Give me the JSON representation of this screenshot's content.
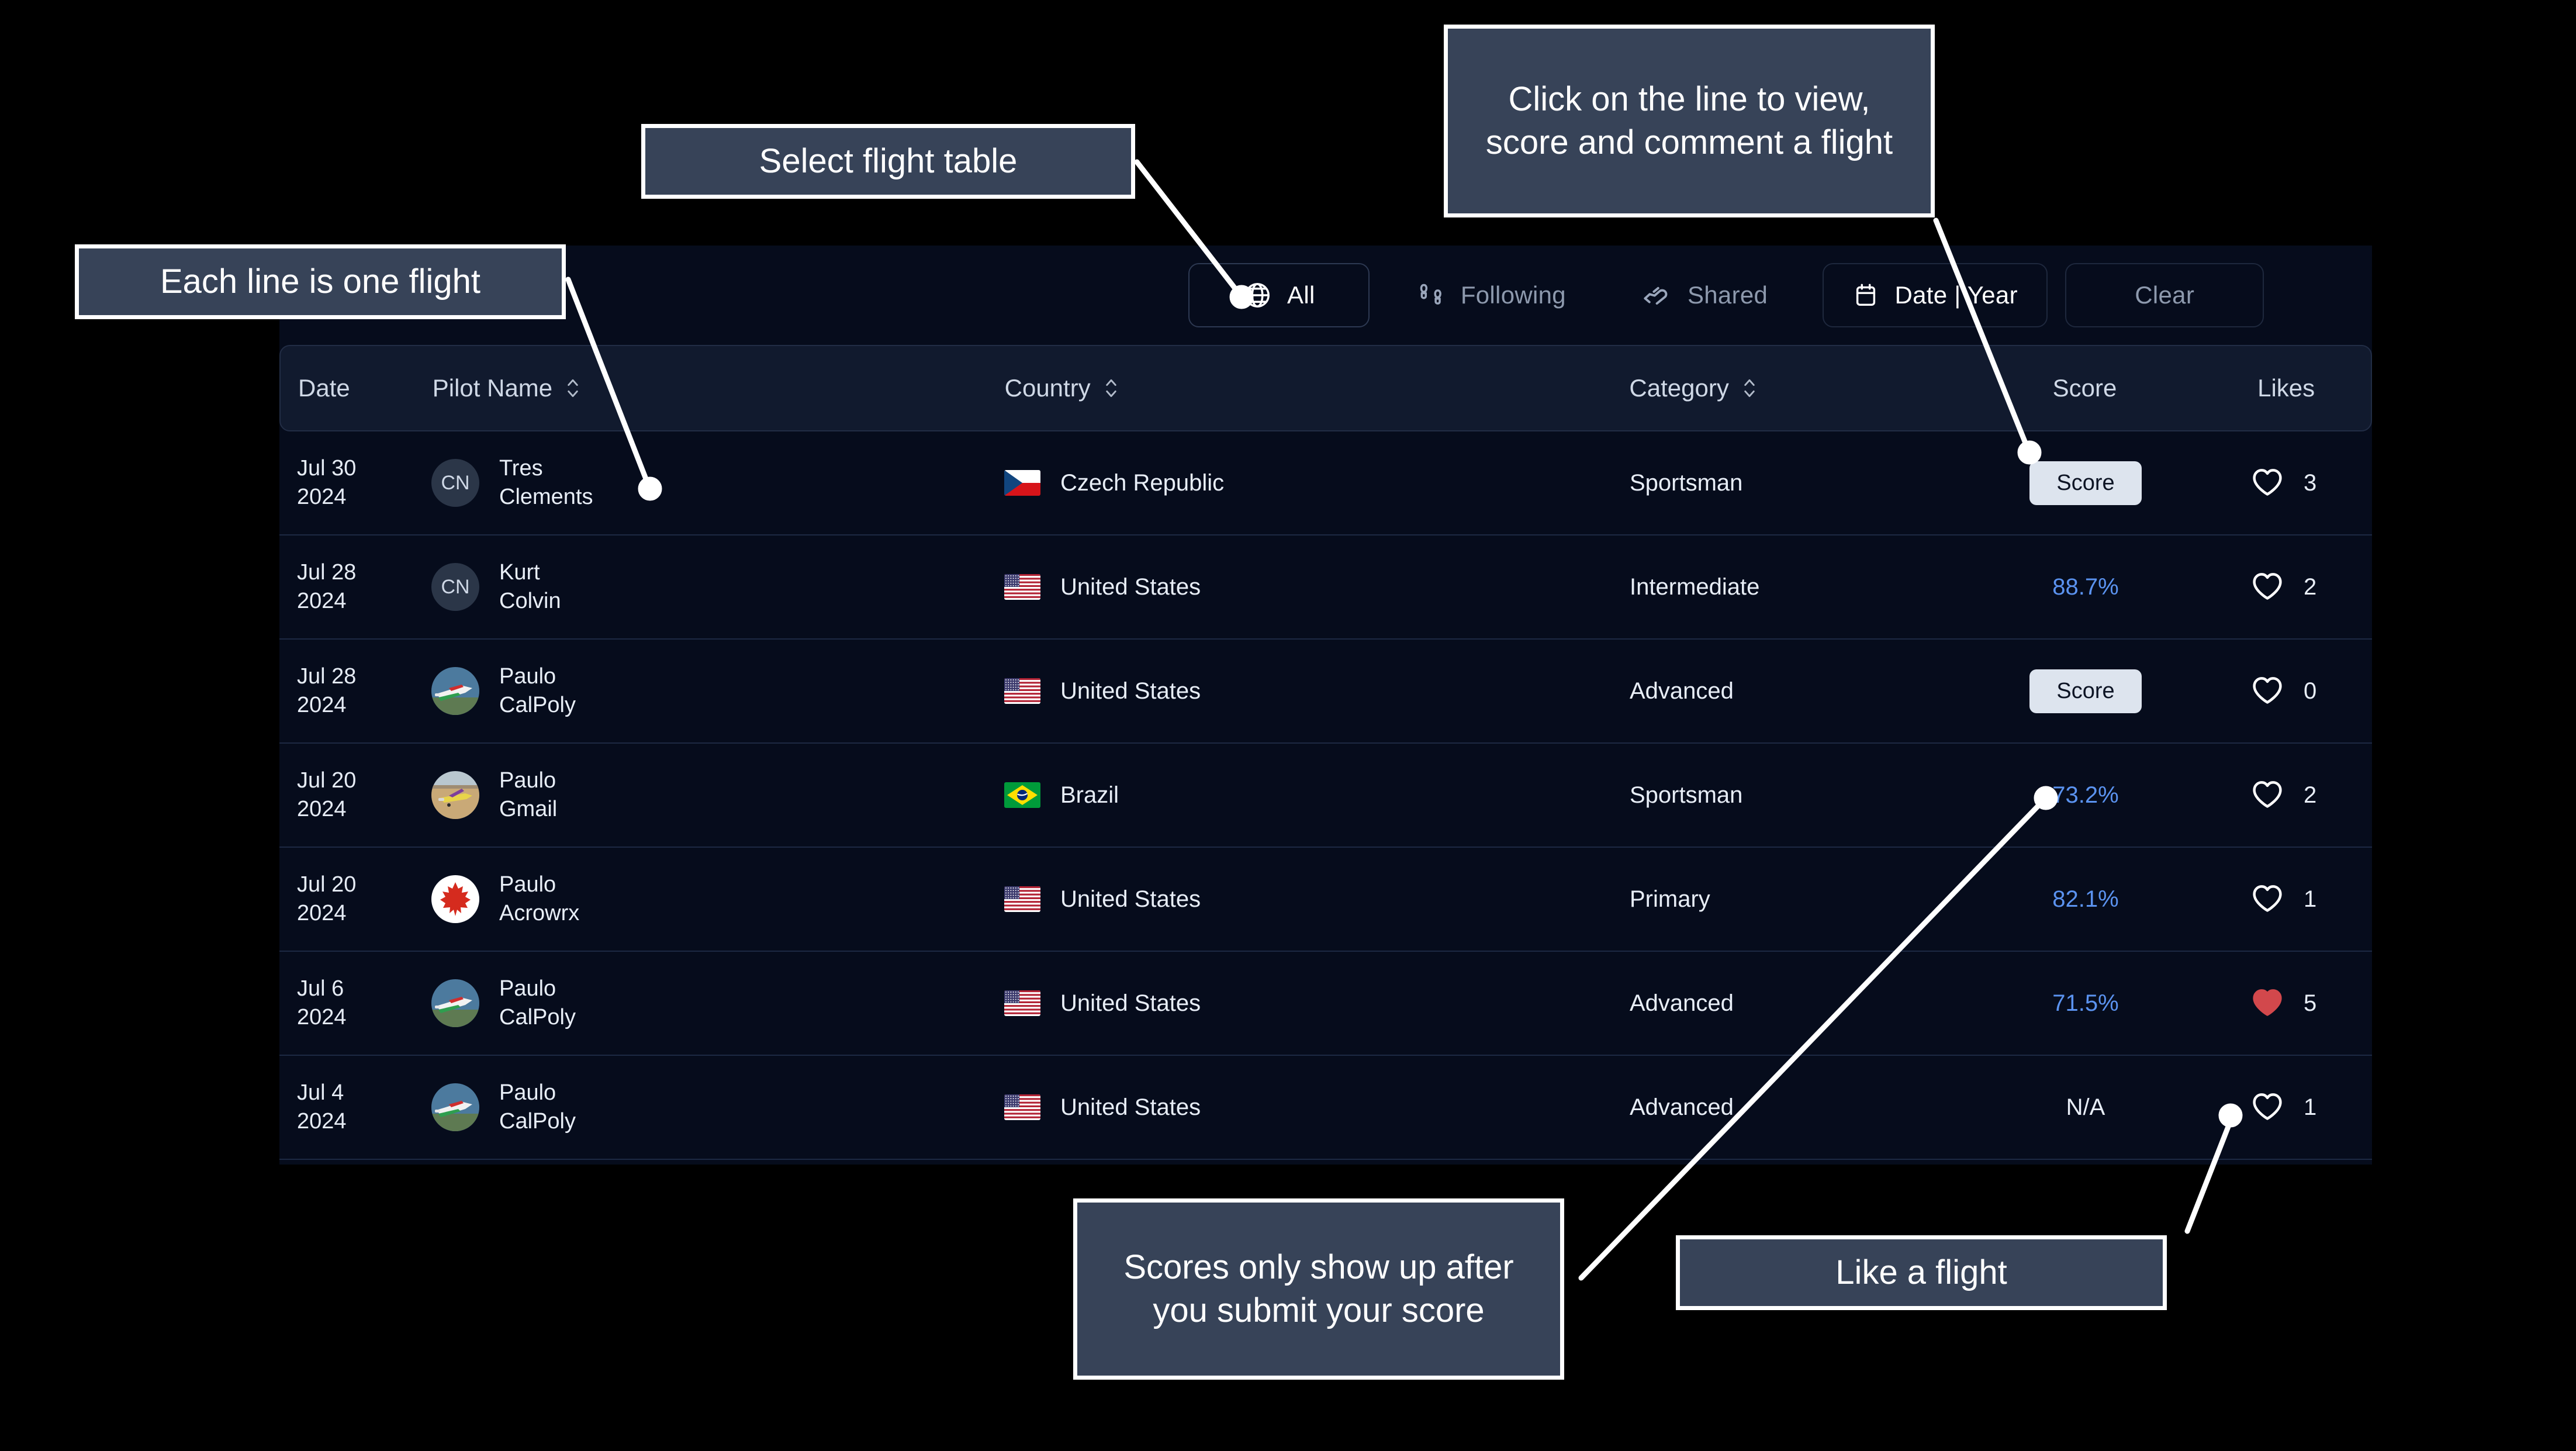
{
  "toolbar": {
    "all_label": "All",
    "following_label": "Following",
    "shared_label": "Shared",
    "date_label": "Date | Year",
    "clear_label": "Clear",
    "icons": {
      "all": "globe-icon",
      "following": "footprints-icon",
      "shared": "handshake-icon",
      "date": "calendar-icon"
    }
  },
  "table": {
    "columns": [
      {
        "key": "date",
        "label": "Date",
        "sortable": false
      },
      {
        "key": "pilot",
        "label": "Pilot Name",
        "sortable": true
      },
      {
        "key": "country",
        "label": "Country",
        "sortable": true
      },
      {
        "key": "category",
        "label": "Category",
        "sortable": true
      },
      {
        "key": "score",
        "label": "Score",
        "sortable": false
      },
      {
        "key": "likes",
        "label": "Likes",
        "sortable": false
      }
    ],
    "rows": [
      {
        "date_day": "Jul 30",
        "date_year": "2024",
        "avatar_type": "initials",
        "avatar_initials": "CN",
        "pilot_first": "Tres",
        "pilot_last": "Clements",
        "country": "Czech Republic",
        "flag": "cz",
        "category": "Sportsman",
        "score_type": "button",
        "score": "Score",
        "likes": "3",
        "liked": false
      },
      {
        "date_day": "Jul 28",
        "date_year": "2024",
        "avatar_type": "initials",
        "avatar_initials": "CN",
        "pilot_first": "Kurt",
        "pilot_last": "Colvin",
        "country": "United States",
        "flag": "us",
        "category": "Intermediate",
        "score_type": "percent",
        "score": "88.7%",
        "likes": "2",
        "liked": false
      },
      {
        "date_day": "Jul 28",
        "date_year": "2024",
        "avatar_type": "photo-plane-blue",
        "avatar_initials": "",
        "pilot_first": "Paulo",
        "pilot_last": "CalPoly",
        "country": "United States",
        "flag": "us",
        "category": "Advanced",
        "score_type": "button",
        "score": "Score",
        "likes": "0",
        "liked": false
      },
      {
        "date_day": "Jul 20",
        "date_year": "2024",
        "avatar_type": "photo-plane-desert",
        "avatar_initials": "",
        "pilot_first": "Paulo",
        "pilot_last": "Gmail",
        "country": "Brazil",
        "flag": "br",
        "category": "Sportsman",
        "score_type": "percent",
        "score": "73.2%",
        "likes": "2",
        "liked": false
      },
      {
        "date_day": "Jul 20",
        "date_year": "2024",
        "avatar_type": "photo-maple-leaf",
        "avatar_initials": "",
        "pilot_first": "Paulo",
        "pilot_last": "Acrowrx",
        "country": "United States",
        "flag": "us",
        "category": "Primary",
        "score_type": "percent",
        "score": "82.1%",
        "likes": "1",
        "liked": false
      },
      {
        "date_day": "Jul 6",
        "date_year": "2024",
        "avatar_type": "photo-plane-blue",
        "avatar_initials": "",
        "pilot_first": "Paulo",
        "pilot_last": "CalPoly",
        "country": "United States",
        "flag": "us",
        "category": "Advanced",
        "score_type": "percent",
        "score": "71.5%",
        "likes": "5",
        "liked": true
      },
      {
        "date_day": "Jul 4",
        "date_year": "2024",
        "avatar_type": "photo-plane-blue",
        "avatar_initials": "",
        "pilot_first": "Paulo",
        "pilot_last": "CalPoly",
        "country": "United States",
        "flag": "us",
        "category": "Advanced",
        "score_type": "na",
        "score": "N/A",
        "likes": "1",
        "liked": false
      }
    ]
  },
  "annotations": [
    {
      "id": "each",
      "text": "Each line is one flight"
    },
    {
      "id": "select",
      "text": "Select flight table"
    },
    {
      "id": "click",
      "text": "Click on the line to view, score and comment a flight"
    },
    {
      "id": "scores",
      "text": "Scores only show up after you submit your score"
    },
    {
      "id": "like",
      "text": "Like a flight"
    }
  ],
  "colors": {
    "page_background": "#000000",
    "app_background": "#060c1c",
    "header_card": "#111a2e",
    "row_divider": "#1d2943",
    "score_link": "#5b93f0",
    "score_button_bg": "#dde4ee",
    "liked_heart": "#d2484c",
    "callout_bg": "#374358",
    "callout_border": "#ffffff",
    "leader_line": "#ffffff"
  }
}
